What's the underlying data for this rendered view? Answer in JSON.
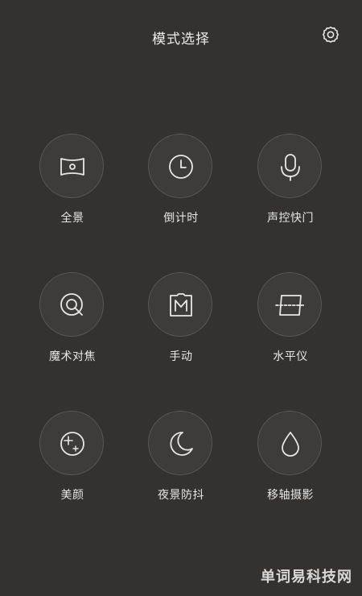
{
  "header": {
    "title": "模式选择",
    "settings_icon": "gear-icon"
  },
  "modes": [
    {
      "label": "全景",
      "icon": "panorama-icon"
    },
    {
      "label": "倒计时",
      "icon": "clock-icon"
    },
    {
      "label": "声控快门",
      "icon": "microphone-icon"
    },
    {
      "label": "魔术对焦",
      "icon": "focus-icon"
    },
    {
      "label": "手动",
      "icon": "manual-icon"
    },
    {
      "label": "水平仪",
      "icon": "level-icon"
    },
    {
      "label": "美颜",
      "icon": "beauty-icon"
    },
    {
      "label": "夜景防抖",
      "icon": "moon-icon"
    },
    {
      "label": "移轴摄影",
      "icon": "drop-icon"
    }
  ],
  "watermark": "单词易科技网",
  "colors": {
    "background": "#333231",
    "circle_fill": "#3d3c3b",
    "circle_border": "#575655",
    "icon_stroke": "#e7e7e7",
    "text": "#e9e9e9"
  }
}
